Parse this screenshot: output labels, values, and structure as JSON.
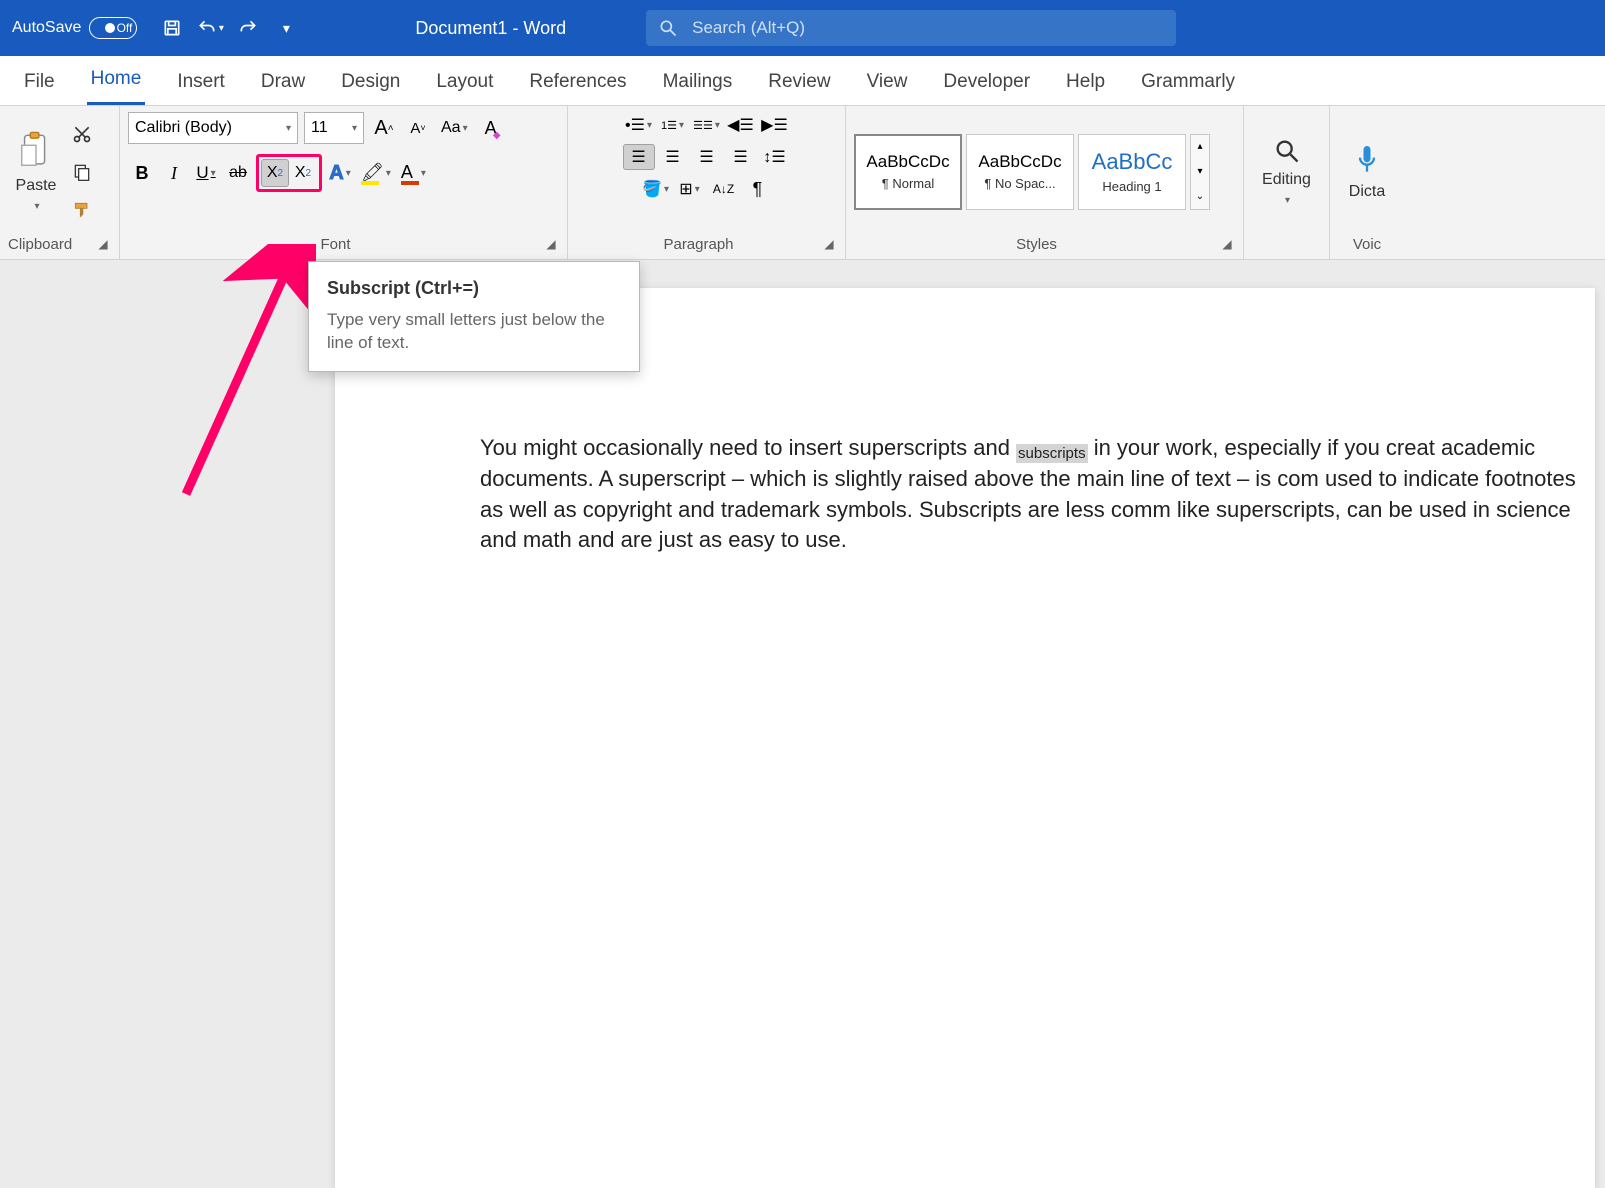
{
  "titleBar": {
    "autosave": "AutoSave",
    "autosaveState": "Off",
    "docTitle": "Document1  -  Word",
    "searchPlaceholder": "Search (Alt+Q)"
  },
  "tabs": [
    "File",
    "Home",
    "Insert",
    "Draw",
    "Design",
    "Layout",
    "References",
    "Mailings",
    "Review",
    "View",
    "Developer",
    "Help",
    "Grammarly"
  ],
  "activeTab": 1,
  "clipboard": {
    "label": "Clipboard",
    "paste": "Paste"
  },
  "font": {
    "label": "Font",
    "name": "Calibri (Body)",
    "size": "11"
  },
  "paragraph": {
    "label": "Paragraph"
  },
  "styles": {
    "label": "Styles",
    "items": [
      {
        "preview": "AaBbCcDc",
        "name": "¶ Normal",
        "cls": "",
        "selected": true
      },
      {
        "preview": "AaBbCcDc",
        "name": "¶ No Spac...",
        "cls": ""
      },
      {
        "preview": "AaBbCc",
        "name": "Heading 1",
        "cls": "h1"
      }
    ]
  },
  "editing": {
    "label": "Editing"
  },
  "voice": {
    "label": "Voic",
    "dictate": "Dicta"
  },
  "tooltip": {
    "title": "Subscript (Ctrl+=)",
    "body": "Type very small letters just below the line of text."
  },
  "document": {
    "pre": "You might occasionally need to insert superscripts and ",
    "selWord": "subscripts",
    "post": " in your work, especially if you creat academic documents. A superscript – which is slightly raised above the main line of text – is com used to indicate footnotes as well as copyright and trademark symbols. Subscripts are less comm like superscripts, can be used in science and math and are just as easy to use."
  }
}
